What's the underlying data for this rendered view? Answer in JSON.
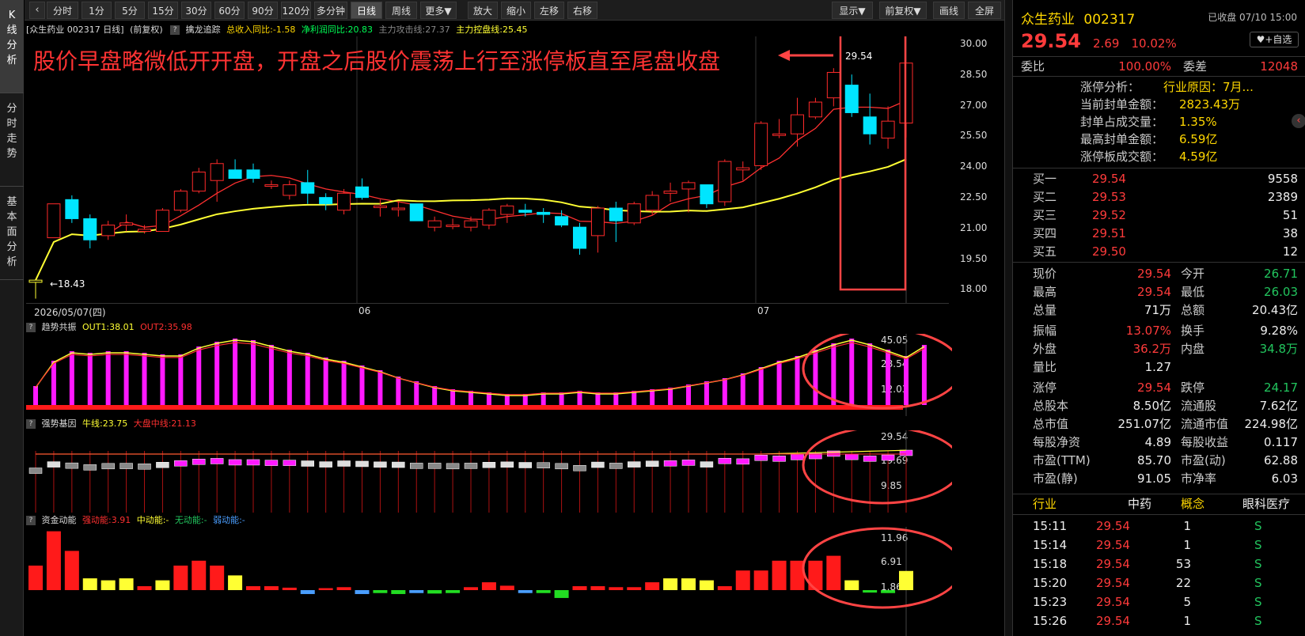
{
  "sidebar": {
    "tabs": [
      {
        "label": "K线分析"
      },
      {
        "label": "分时走势"
      },
      {
        "label": "基本面分析"
      }
    ]
  },
  "toolbar": {
    "intervals": [
      "分时",
      "1分",
      "5分",
      "15分",
      "30分",
      "60分",
      "90分",
      "120分",
      "多分钟",
      "日线",
      "周线",
      "更多▼"
    ],
    "actions": [
      "放大",
      "缩小",
      "左移",
      "右移"
    ],
    "right": [
      "显示▼",
      "前复权▼",
      "画线",
      "全屏"
    ]
  },
  "main_header": {
    "name": "[众生药业 002317 日线]",
    "adjust": "(前复权)",
    "indicator": "擒龙追踪",
    "rev": "总收入同比:-1.58",
    "profit": "净利润同比:20.83",
    "attack": "主力攻击线:27.37",
    "control": "主力控盘线:25.45"
  },
  "annotation": "股价早盘略微低开开盘，开盘之后股价震荡上行至涨停板直至尾盘收盘",
  "price_labels": {
    "last": "29.54",
    "low": "18.43"
  },
  "y_axis": [
    "30.00",
    "28.50",
    "27.00",
    "25.50",
    "24.00",
    "22.50",
    "21.00",
    "19.50",
    "18.00"
  ],
  "x_axis": {
    "start": "2026/05/07(四)",
    "m1": "06",
    "m2": "07"
  },
  "panel1": {
    "name": "趋势共振",
    "out1": "OUT1:38.01",
    "out2": "OUT2:35.98",
    "ticks": [
      "45.05",
      "28.54",
      "12.03"
    ]
  },
  "panel2": {
    "name": "强势基因",
    "bull": "牛线:23.75",
    "market": "大盘中线:21.13",
    "ticks": [
      "29.54",
      "19.69",
      "9.85"
    ]
  },
  "panel3": {
    "name": "资金动能",
    "strong": "强动能:3.91",
    "mid": "中动能:-",
    "none": "无动能:-",
    "weak": "弱动能:-",
    "ticks": [
      "11.96",
      "6.91",
      "1.86"
    ]
  },
  "colors": {
    "up": "#ff2a2a",
    "down": "#00e5ff",
    "ma5": "#ff3030",
    "ma20": "#ffff33",
    "magenta": "#ff19ff",
    "annot": "#ff3333"
  },
  "quote": {
    "name": "众生药业",
    "code": "002317",
    "status": "已收盘 07/10 15:00",
    "price": "29.54",
    "change": "2.69",
    "pct": "10.02%",
    "fav": "♥+自选",
    "weibi_label": "委比",
    "weibi": "100.00%",
    "weicha_label": "委差",
    "weicha": "12048",
    "limit_analysis": [
      {
        "label": "涨停分析：",
        "value": "行业原因：7月..."
      },
      {
        "label": "当前封单金额：",
        "value": "2823.43万"
      },
      {
        "label": "封单占成交量：",
        "value": "1.35%"
      },
      {
        "label": "最高封单金额：",
        "value": "6.59亿"
      },
      {
        "label": "涨停板成交额：",
        "value": "4.59亿"
      }
    ],
    "bids": [
      {
        "label": "买一",
        "price": "29.54",
        "vol": "9558"
      },
      {
        "label": "买二",
        "price": "29.53",
        "vol": "2389"
      },
      {
        "label": "买三",
        "price": "29.52",
        "vol": "51"
      },
      {
        "label": "买四",
        "price": "29.51",
        "vol": "38"
      },
      {
        "label": "买五",
        "price": "29.50",
        "vol": "12"
      }
    ],
    "stats": [
      {
        "l1": "现价",
        "v1": "29.54",
        "c1": "red",
        "l2": "今开",
        "v2": "26.71",
        "c2": "green"
      },
      {
        "l1": "最高",
        "v1": "29.54",
        "c1": "red",
        "l2": "最低",
        "v2": "26.03",
        "c2": "green"
      },
      {
        "l1": "总量",
        "v1": "71万",
        "c1": "white",
        "l2": "总额",
        "v2": "20.43亿",
        "c2": "white"
      },
      {
        "l1": "振幅",
        "v1": "13.07%",
        "c1": "red",
        "l2": "换手",
        "v2": "9.28%",
        "c2": "white"
      },
      {
        "l1": "外盘",
        "v1": "36.2万",
        "c1": "red",
        "l2": "内盘",
        "v2": "34.8万",
        "c2": "green"
      },
      {
        "l1": "量比",
        "v1": "1.27",
        "c1": "white",
        "l2": "",
        "v2": "",
        "c2": "white"
      },
      {
        "l1": "涨停",
        "v1": "29.54",
        "c1": "red",
        "l2": "跌停",
        "v2": "24.17",
        "c2": "green"
      },
      {
        "l1": "总股本",
        "v1": "8.50亿",
        "c1": "white",
        "l2": "流通股",
        "v2": "7.62亿",
        "c2": "white"
      },
      {
        "l1": "总市值",
        "v1": "251.07亿",
        "c1": "white",
        "l2": "流通市值",
        "v2": "224.98亿",
        "c2": "white"
      },
      {
        "l1": "每股净资",
        "v1": "4.89",
        "c1": "white",
        "l2": "每股收益",
        "v2": "0.117",
        "c2": "white"
      },
      {
        "l1": "市盈(TTM)",
        "v1": "85.70",
        "c1": "white",
        "l2": "市盈(动)",
        "v2": "62.88",
        "c2": "white"
      },
      {
        "l1": "市盈(静)",
        "v1": "91.05",
        "c1": "white",
        "l2": "市净率",
        "v2": "6.03",
        "c2": "white"
      }
    ],
    "industry": {
      "l1": "行业",
      "v1": "中药",
      "l2": "概念",
      "v2": "眼科医疗"
    },
    "trades": [
      {
        "t": "15:11",
        "p": "29.54",
        "v": "1",
        "s": "S"
      },
      {
        "t": "15:14",
        "p": "29.54",
        "v": "1",
        "s": "S"
      },
      {
        "t": "15:18",
        "p": "29.54",
        "v": "53",
        "s": "S"
      },
      {
        "t": "15:20",
        "p": "29.54",
        "v": "22",
        "s": "S"
      },
      {
        "t": "15:23",
        "p": "29.54",
        "v": "5",
        "s": "S"
      },
      {
        "t": "15:26",
        "p": "29.54",
        "v": "1",
        "s": "S"
      }
    ]
  },
  "chart_data": [
    {
      "type": "candlestick",
      "title": "众生药业 002317 日线",
      "ylim": [
        18.0,
        30.5
      ],
      "ma_series": [
        "主力攻击线",
        "主力控盘线"
      ],
      "ohlc": [
        [
          19.2,
          19.3,
          18.43,
          19.3
        ],
        [
          21.3,
          22.9,
          21.3,
          22.9
        ],
        [
          23.1,
          23.3,
          22.0,
          22.2
        ],
        [
          22.2,
          22.4,
          20.8,
          21.2
        ],
        [
          21.4,
          22.1,
          21.2,
          21.9
        ],
        [
          21.9,
          22.4,
          21.6,
          22.0
        ],
        [
          21.6,
          21.9,
          21.5,
          21.7
        ],
        [
          21.6,
          22.7,
          21.6,
          22.6
        ],
        [
          22.6,
          23.6,
          22.5,
          23.5
        ],
        [
          23.5,
          24.6,
          23.4,
          24.4
        ],
        [
          24.0,
          25.0,
          23.0,
          24.8
        ],
        [
          24.5,
          25.0,
          24.1,
          24.1
        ],
        [
          24.5,
          24.8,
          23.9,
          24.1
        ],
        [
          23.8,
          24.0,
          23.6,
          23.8
        ],
        [
          23.3,
          24.0,
          23.1,
          23.8
        ],
        [
          23.9,
          24.5,
          22.9,
          23.4
        ],
        [
          23.2,
          23.4,
          22.6,
          22.9
        ],
        [
          22.6,
          23.6,
          22.4,
          23.4
        ],
        [
          23.7,
          24.1,
          23.1,
          23.2
        ],
        [
          22.8,
          23.1,
          22.3,
          22.8
        ],
        [
          22.7,
          23.0,
          22.3,
          22.7
        ],
        [
          22.9,
          22.9,
          22.1,
          22.1
        ],
        [
          21.8,
          22.3,
          21.6,
          22.1
        ],
        [
          21.9,
          22.2,
          21.7,
          21.9
        ],
        [
          21.8,
          22.3,
          21.6,
          22.1
        ],
        [
          21.9,
          22.7,
          21.7,
          22.6
        ],
        [
          22.4,
          22.9,
          22.0,
          22.8
        ],
        [
          22.6,
          22.9,
          22.3,
          22.5
        ],
        [
          22.5,
          22.7,
          22.0,
          22.4
        ],
        [
          22.3,
          22.6,
          21.8,
          21.9
        ],
        [
          21.8,
          22.0,
          20.5,
          20.8
        ],
        [
          21.4,
          22.8,
          20.6,
          22.7
        ],
        [
          22.7,
          23.0,
          21.1,
          22.1
        ],
        [
          22.0,
          23.0,
          21.9,
          22.9
        ],
        [
          22.6,
          23.5,
          22.4,
          23.3
        ],
        [
          23.4,
          23.9,
          23.0,
          23.5
        ],
        [
          23.6,
          24.0,
          22.5,
          23.9
        ],
        [
          23.8,
          23.8,
          22.7,
          22.9
        ],
        [
          23.0,
          25.0,
          22.8,
          24.9
        ],
        [
          24.5,
          24.9,
          24.0,
          24.6
        ],
        [
          24.7,
          26.8,
          24.5,
          26.7
        ],
        [
          26.2,
          26.9,
          26.0,
          26.2
        ],
        [
          26.2,
          27.9,
          25.6,
          27.1
        ],
        [
          27.0,
          27.9,
          26.9,
          27.7
        ],
        [
          27.9,
          29.3,
          27.5,
          29.1
        ],
        [
          28.5,
          29.0,
          27.0,
          27.2
        ],
        [
          27.0,
          28.1,
          25.7,
          26.2
        ],
        [
          26.0,
          27.5,
          25.5,
          26.8
        ],
        [
          26.71,
          29.54,
          26.03,
          29.54
        ]
      ],
      "mini_values": [
        "29.54",
        "18.43"
      ]
    },
    {
      "type": "bar",
      "title": "趋势共振",
      "series": [
        {
          "name": "OUT1",
          "values": [
            12,
            28,
            34,
            33,
            34,
            34,
            33,
            32,
            32,
            37,
            40,
            42,
            41,
            38,
            35,
            33,
            30,
            28,
            25,
            22,
            18,
            15,
            12,
            10,
            9,
            8,
            7,
            7,
            8,
            8,
            9,
            8,
            8,
            9,
            10,
            11,
            13,
            15,
            17,
            20,
            24,
            28,
            31,
            35,
            39,
            42,
            39,
            35,
            31,
            38
          ]
        }
      ]
    },
    {
      "type": "bar",
      "title": "资金动能",
      "series": [
        {
          "name": "强动能",
          "values": [
            5,
            12,
            8,
            2.4,
            2.0,
            2.4,
            0.8,
            2.0,
            5,
            6,
            5,
            3,
            0.8,
            0.8,
            0.5,
            -0.8,
            0.4,
            0.6,
            -0.8,
            -0.6,
            -0.8,
            -0.6,
            -0.7,
            -0.6,
            0.6,
            1.6,
            0.9,
            -0.6,
            -0.6,
            -1.6,
            0.8,
            0.8,
            0.6,
            0.6,
            1.6,
            2.4,
            2.4,
            2.0,
            0.8,
            4,
            4,
            6,
            6,
            6,
            7,
            2,
            -0.5,
            -0.6,
            3.91
          ]
        }
      ]
    }
  ]
}
